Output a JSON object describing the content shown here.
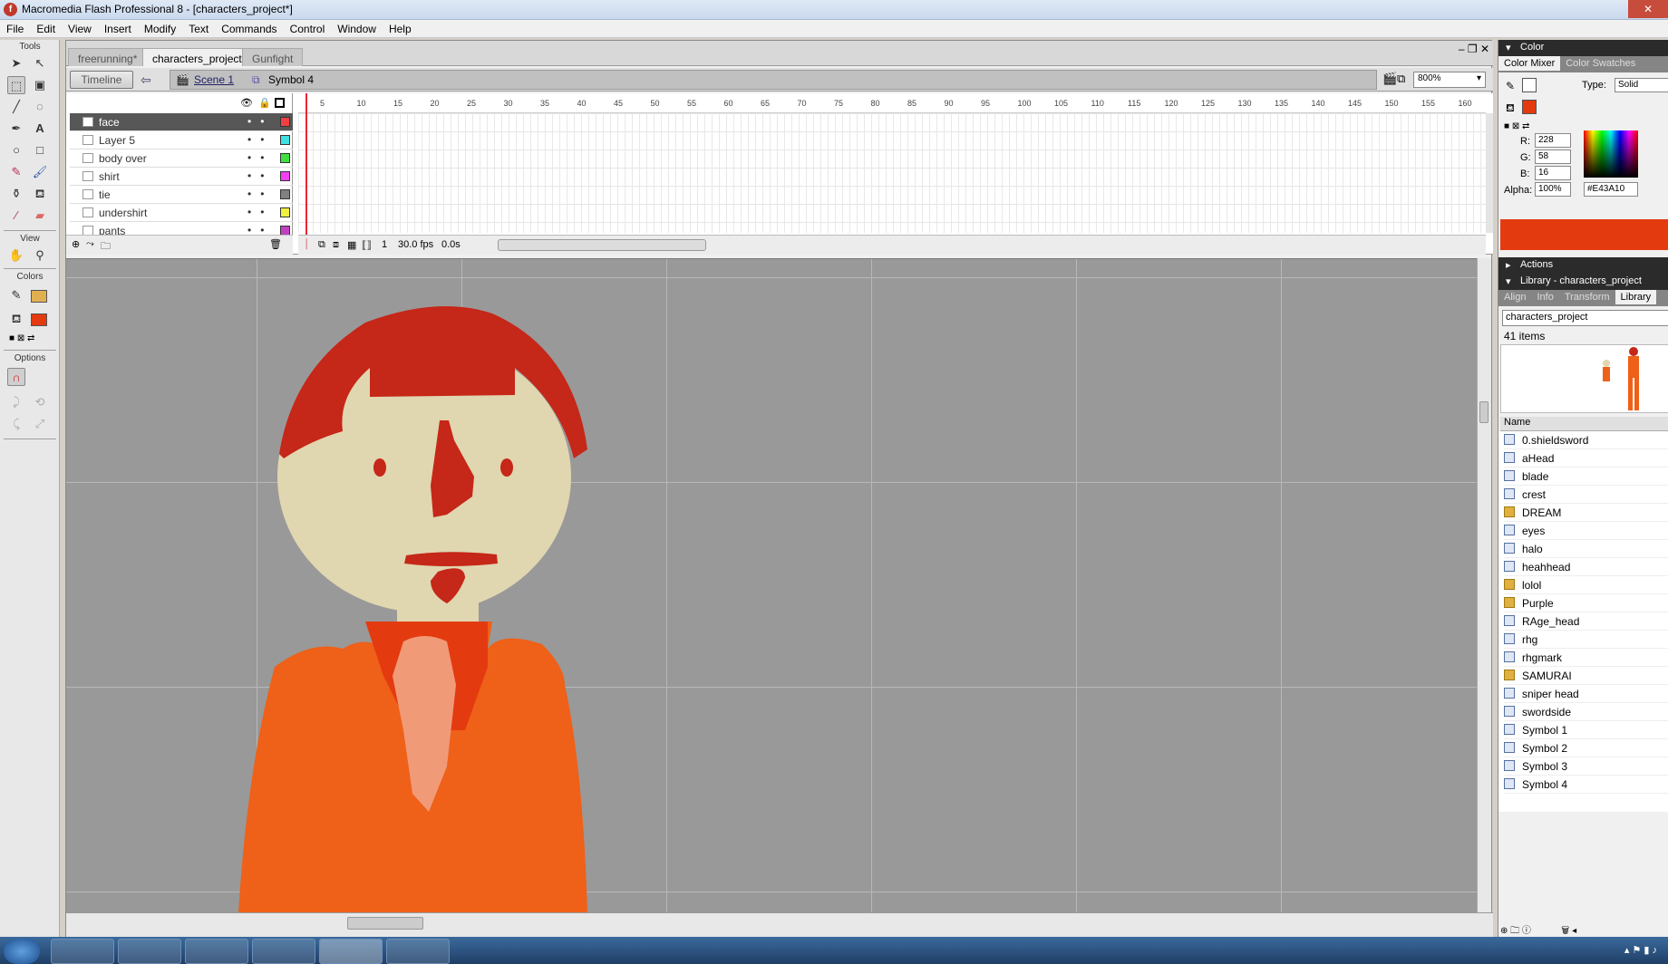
{
  "window": {
    "title": "Macromedia Flash Professional 8 - [characters_project*]"
  },
  "menu": [
    "File",
    "Edit",
    "View",
    "Insert",
    "Modify",
    "Text",
    "Commands",
    "Control",
    "Window",
    "Help"
  ],
  "tools": {
    "tools_label": "Tools",
    "view_label": "View",
    "colors_label": "Colors",
    "options_label": "Options"
  },
  "doc_tabs": [
    "freerunning*",
    "characters_project*",
    "Gunfight"
  ],
  "editbar": {
    "timeline_button": "Timeline",
    "scene": "Scene 1",
    "symbol": "Symbol 4",
    "zoom": "800%"
  },
  "layers": [
    {
      "name": "face",
      "color": "#f04040",
      "selected": true
    },
    {
      "name": "Layer 5",
      "color": "#40e0e0"
    },
    {
      "name": "body over",
      "color": "#40e040"
    },
    {
      "name": "shirt",
      "color": "#f040f0"
    },
    {
      "name": "tie",
      "color": "#808080"
    },
    {
      "name": "undershirt",
      "color": "#f0f040"
    },
    {
      "name": "pants",
      "color": "#c040c0"
    }
  ],
  "ruler_ticks": [
    "5",
    "10",
    "15",
    "20",
    "25",
    "30",
    "35",
    "40",
    "45",
    "50",
    "55",
    "60",
    "65",
    "70",
    "75",
    "80",
    "85",
    "90",
    "95",
    "100",
    "105",
    "110",
    "115",
    "120",
    "125",
    "130",
    "135",
    "140",
    "145",
    "150",
    "155",
    "160"
  ],
  "timeline_status": {
    "frame": "1",
    "fps": "30.0 fps",
    "time": "0.0s"
  },
  "color_panel": {
    "title": "Color",
    "tab_mixer": "Color Mixer",
    "tab_swatches": "Color Swatches",
    "type_label": "Type:",
    "type_value": "Solid",
    "r_label": "R:",
    "r_value": "228",
    "g_label": "G:",
    "g_value": "58",
    "b_label": "B:",
    "b_value": "16",
    "alpha_label": "Alpha:",
    "alpha_value": "100%",
    "hex": "#E43A10",
    "swatch_color": "#e43a10"
  },
  "actions_panel": {
    "title": "Actions"
  },
  "library": {
    "title": "Library - characters_project",
    "tabs": [
      "Align",
      "Info",
      "Transform",
      "Library"
    ],
    "doc": "characters_project",
    "count": "41 items",
    "name_header": "Name",
    "items": [
      {
        "name": "0.shieldsword",
        "type": "symbol"
      },
      {
        "name": "aHead",
        "type": "symbol"
      },
      {
        "name": "blade",
        "type": "symbol"
      },
      {
        "name": "crest",
        "type": "symbol"
      },
      {
        "name": "DREAM",
        "type": "folder"
      },
      {
        "name": "eyes",
        "type": "symbol"
      },
      {
        "name": "halo",
        "type": "symbol"
      },
      {
        "name": "heahhead",
        "type": "symbol"
      },
      {
        "name": "lolol",
        "type": "folder"
      },
      {
        "name": "Purple",
        "type": "folder"
      },
      {
        "name": "RAge_head",
        "type": "symbol"
      },
      {
        "name": "rhg",
        "type": "symbol"
      },
      {
        "name": "rhgmark",
        "type": "symbol"
      },
      {
        "name": "SAMURAI",
        "type": "folder"
      },
      {
        "name": "sniper head",
        "type": "symbol"
      },
      {
        "name": "swordside",
        "type": "symbol"
      },
      {
        "name": "Symbol 1",
        "type": "symbol"
      },
      {
        "name": "Symbol 2",
        "type": "symbol"
      },
      {
        "name": "Symbol 3",
        "type": "symbol"
      },
      {
        "name": "Symbol 4",
        "type": "symbol"
      }
    ]
  },
  "icons": {
    "close": "close-icon",
    "eye": "eye-icon",
    "lock": "lock-icon"
  }
}
